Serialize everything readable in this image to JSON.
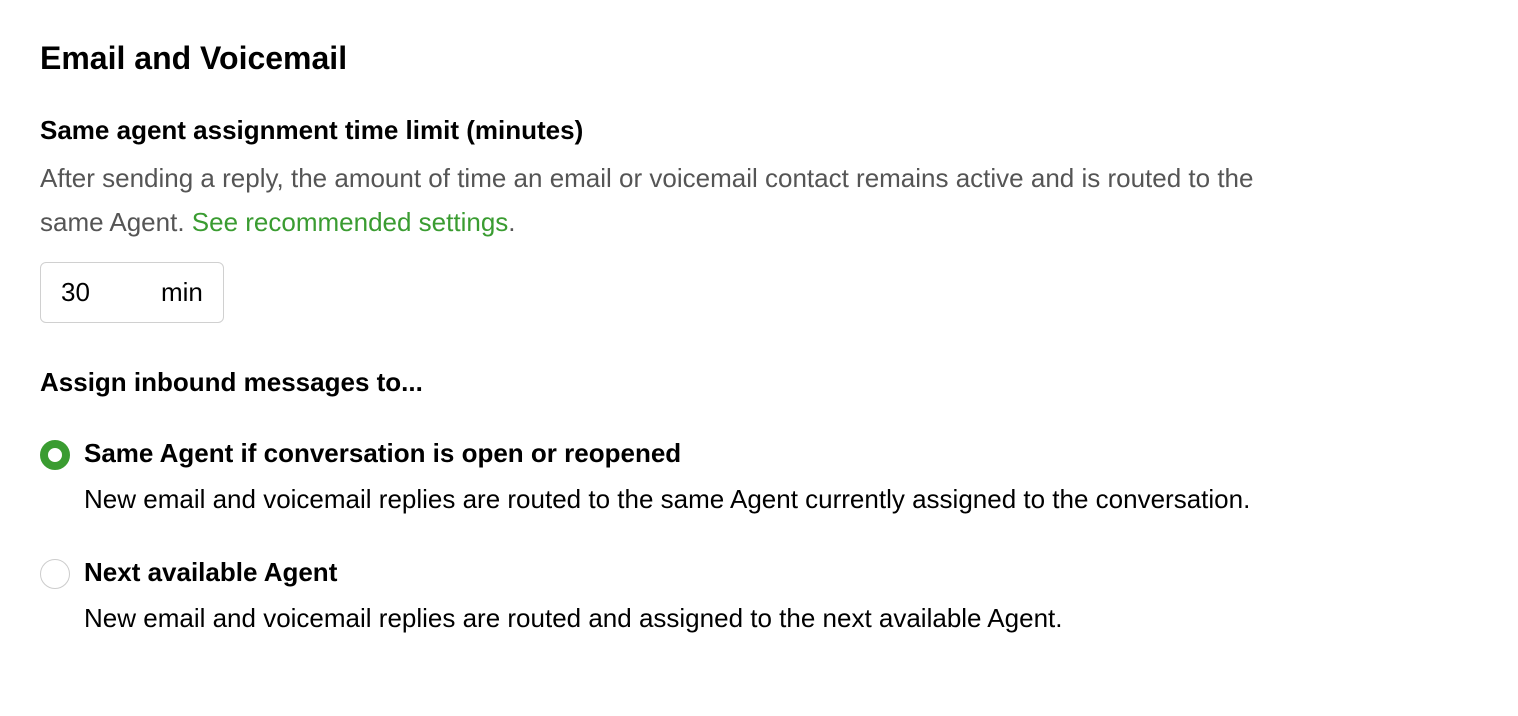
{
  "section": {
    "title": "Email and Voicemail"
  },
  "time_limit": {
    "label": "Same agent assignment time limit (minutes)",
    "description": "After sending a reply, the amount of time an email or voicemail contact remains active and is routed to the same Agent. ",
    "link_text": "See recommended settings",
    "period": ".",
    "value": "30",
    "unit": "min"
  },
  "assignment": {
    "label": "Assign inbound messages to...",
    "options": [
      {
        "label": "Same Agent if conversation is open or reopened",
        "description": "New email and voicemail replies are routed to the same Agent currently assigned to the conversation.",
        "checked": true
      },
      {
        "label": "Next available Agent",
        "description": "New email and voicemail replies are routed and assigned to the next available Agent.",
        "checked": false
      }
    ]
  }
}
